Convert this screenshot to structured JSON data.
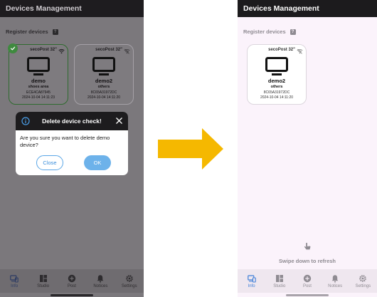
{
  "app": {
    "title": "Devices Management"
  },
  "section": {
    "label": "Register devices",
    "help_glyph": "?"
  },
  "before": {
    "devices": [
      {
        "model": "secoPost 32\"",
        "name": "demo",
        "group": "shoes area",
        "mac": "ECE4CA87945",
        "time": "2024-10-04 14:11:23",
        "status_icon": "wifi-icon",
        "selected": true
      },
      {
        "model": "secoPost 32\"",
        "name": "demo2",
        "group": "others",
        "mac": "8C65A31972DC",
        "time": "2024-10-04 14:11:20",
        "status_icon": "wifi-off-icon",
        "selected": false
      }
    ],
    "dialog": {
      "title": "Delete device check!",
      "message": "Are you sure you want to delete demo device?",
      "cancel_label": "Close",
      "ok_label": "OK"
    }
  },
  "after": {
    "devices": [
      {
        "model": "secoPost 32\"",
        "name": "demo2",
        "group": "others",
        "mac": "8C65A31972DC",
        "time": "2024-10-04 14:11:20",
        "status_icon": "wifi-off-icon"
      }
    ],
    "refresh_hint": "Swipe down to refresh"
  },
  "nav": {
    "items": [
      {
        "label": "Info",
        "icon": "devices-icon",
        "active": true
      },
      {
        "label": "Studio",
        "icon": "dashboard-icon",
        "active": false
      },
      {
        "label": "Post",
        "icon": "add-circle-icon",
        "active": false
      },
      {
        "label": "Notices",
        "icon": "bell-icon",
        "active": false
      },
      {
        "label": "Settings",
        "icon": "gear-icon",
        "active": false
      }
    ]
  },
  "colors": {
    "accent": "#3f7fd8",
    "arrow": "#f5b800",
    "ok_button": "#6db2ea",
    "header": "#1c1b1d",
    "selected_border": "#2f6b2f"
  }
}
